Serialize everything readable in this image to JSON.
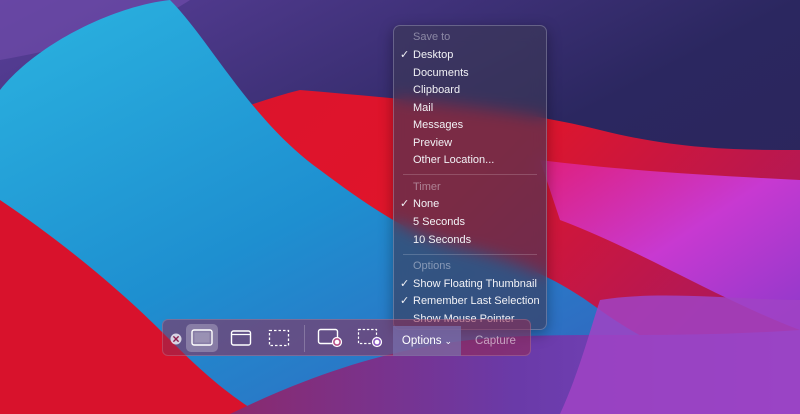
{
  "menu": {
    "sections": [
      {
        "header": "Save to",
        "items": [
          {
            "label": "Desktop",
            "checked": true
          },
          {
            "label": "Documents",
            "checked": false
          },
          {
            "label": "Clipboard",
            "checked": false
          },
          {
            "label": "Mail",
            "checked": false
          },
          {
            "label": "Messages",
            "checked": false
          },
          {
            "label": "Preview",
            "checked": false
          },
          {
            "label": "Other Location...",
            "checked": false
          }
        ]
      },
      {
        "header": "Timer",
        "items": [
          {
            "label": "None",
            "checked": true
          },
          {
            "label": "5 Seconds",
            "checked": false
          },
          {
            "label": "10 Seconds",
            "checked": false
          }
        ]
      },
      {
        "header": "Options",
        "items": [
          {
            "label": "Show Floating Thumbnail",
            "checked": true
          },
          {
            "label": "Remember Last Selection",
            "checked": true
          },
          {
            "label": "Show Mouse Pointer",
            "checked": false
          }
        ]
      }
    ],
    "check_glyph": "✓"
  },
  "toolbar": {
    "tools": [
      {
        "name": "capture-entire-screen",
        "selected": true
      },
      {
        "name": "capture-window",
        "selected": false
      },
      {
        "name": "capture-selection",
        "selected": false
      },
      {
        "name": "record-entire-screen",
        "selected": false
      },
      {
        "name": "record-selection",
        "selected": false
      }
    ],
    "options_label": "Options",
    "options_chevron": "⌄",
    "capture_label": "Capture"
  },
  "colors": {
    "wallpaper_blue": "#1fa4d8",
    "wallpaper_red": "#e3102a",
    "wallpaper_purple": "#3b2a6e",
    "wallpaper_magenta": "#c43cd6"
  }
}
